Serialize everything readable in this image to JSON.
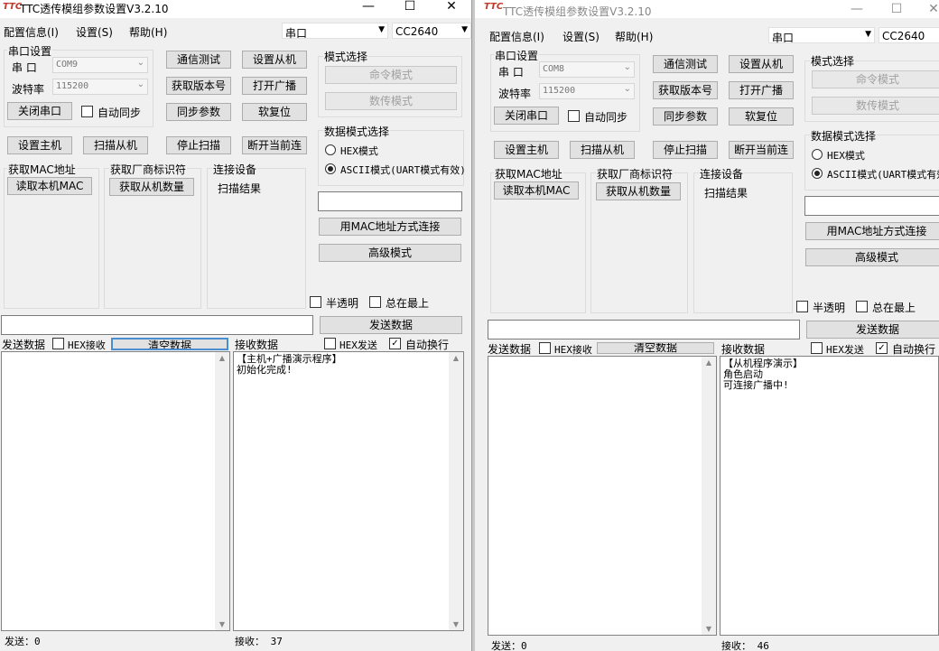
{
  "windows": [
    {
      "logo": "TTC",
      "title": "TTC透传模组参数设置V3.2.10",
      "menu": [
        "配置信息(I)",
        "设置(S)",
        "帮助(H)"
      ],
      "port_type": "串口",
      "module": "CC2640",
      "serial": {
        "group": "串口设置",
        "port_label": "串 口",
        "port_value": "COM9",
        "baud_label": "波特率",
        "baud_value": "115200",
        "close_btn": "关闭串口",
        "auto_sync": "自动同步"
      },
      "buttons": {
        "comm_test": "通信测试",
        "set_slave": "设置从机",
        "get_version": "获取版本号",
        "open_broadcast": "打开广播",
        "sync_params": "同步参数",
        "soft_reset": "软复位",
        "set_master": "设置主机",
        "scan_slave": "扫描从机",
        "stop_scan": "停止扫描",
        "disconnect": "断开当前连"
      },
      "mode": {
        "group": "模式选择",
        "command_mode": "命令模式",
        "data_mode": "数传模式"
      },
      "data_mode": {
        "group": "数据模式选择",
        "hex_mode": "HEX模式",
        "ascii_mode": "ASCII模式(UART模式有效)",
        "selected": "ascii"
      },
      "mac_group": "获取MAC地址",
      "read_mac": "读取本机MAC",
      "vendor_group": "获取厂商标识符",
      "get_slave_count": "获取从机数量",
      "conn_group": "连接设备",
      "scan_result": "扫描结果",
      "mac_connect": "用MAC地址方式连接",
      "advanced": "高级模式",
      "semi_transparent": "半透明",
      "always_top": "总在最上",
      "send_btn": "发送数据",
      "send_label": "发送数据",
      "hex_receive": "HEX接收",
      "clear_btn": "清空数据",
      "recv_label": "接收数据",
      "hex_send": "HEX发送",
      "auto_wrap": "自动换行",
      "auto_wrap_checked": true,
      "received_lines": [
        "【主机+广播演示程序】",
        "初始化完成!"
      ],
      "sent_status": "发送：0",
      "recv_status": "接收：  37"
    },
    {
      "logo": "TTC",
      "title": "TTC透传模组参数设置V3.2.10",
      "menu": [
        "配置信息(I)",
        "设置(S)",
        "帮助(H)"
      ],
      "port_type": "串口",
      "module": "CC2640",
      "serial": {
        "group": "串口设置",
        "port_label": "串 口",
        "port_value": "COM8",
        "baud_label": "波特率",
        "baud_value": "115200",
        "close_btn": "关闭串口",
        "auto_sync": "自动同步"
      },
      "buttons": {
        "comm_test": "通信测试",
        "set_slave": "设置从机",
        "get_version": "获取版本号",
        "open_broadcast": "打开广播",
        "sync_params": "同步参数",
        "soft_reset": "软复位",
        "set_master": "设置主机",
        "scan_slave": "扫描从机",
        "stop_scan": "停止扫描",
        "disconnect": "断开当前连"
      },
      "mode": {
        "group": "模式选择",
        "command_mode": "命令模式",
        "data_mode": "数传模式"
      },
      "data_mode": {
        "group": "数据模式选择",
        "hex_mode": "HEX模式",
        "ascii_mode": "ASCII模式(UART模式有效)",
        "selected": "ascii"
      },
      "mac_group": "获取MAC地址",
      "read_mac": "读取本机MAC",
      "vendor_group": "获取厂商标识符",
      "get_slave_count": "获取从机数量",
      "conn_group": "连接设备",
      "scan_result": "扫描结果",
      "mac_connect": "用MAC地址方式连接",
      "advanced": "高级模式",
      "semi_transparent": "半透明",
      "always_top": "总在最上",
      "send_btn": "发送数据",
      "send_label": "发送数据",
      "hex_receive": "HEX接收",
      "clear_btn": "清空数据",
      "recv_label": "接收数据",
      "hex_send": "HEX发送",
      "auto_wrap": "自动换行",
      "auto_wrap_checked": true,
      "received_lines": [
        "【从机程序演示】",
        "角色启动",
        "可连接广播中!"
      ],
      "sent_status": "发送：0",
      "recv_status": "接收：  46"
    }
  ],
  "window_controls": {
    "minimize": "—",
    "maximize": "☐",
    "close": "✕"
  },
  "colors": {
    "logo": "#c0392b",
    "focus_border": "#4a8ed0"
  }
}
